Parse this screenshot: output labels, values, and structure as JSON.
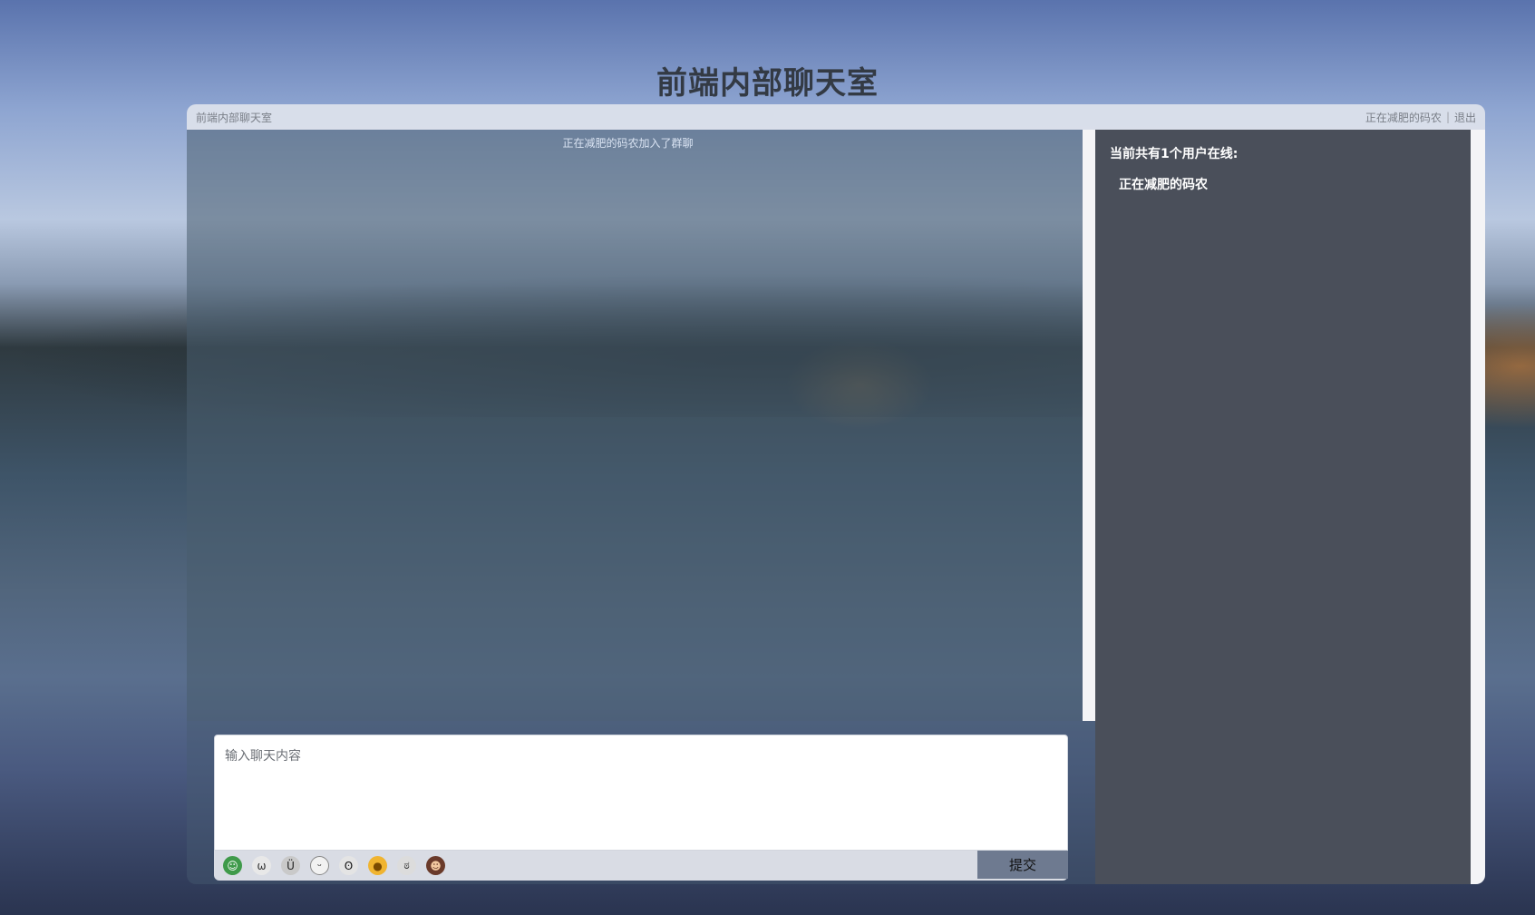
{
  "page": {
    "title": "前端内部聊天室"
  },
  "window": {
    "title": "前端内部聊天室",
    "current_user": "正在减肥的码农",
    "separator": "|",
    "logout_label": "退出"
  },
  "messages": [
    {
      "type": "system",
      "text": "正在减肥的码农加入了群聊"
    }
  ],
  "composer": {
    "placeholder": "输入聊天内容",
    "value": "",
    "submit_label": "提交",
    "emojis": [
      "emoji-1-icon",
      "emoji-2-icon",
      "emoji-3-icon",
      "emoji-4-icon",
      "emoji-5-icon",
      "emoji-6-icon",
      "emoji-7-icon",
      "emoji-8-icon"
    ]
  },
  "users_panel": {
    "count_text": "当前共有1个用户在线:",
    "users": [
      "正在减肥的码农"
    ]
  }
}
